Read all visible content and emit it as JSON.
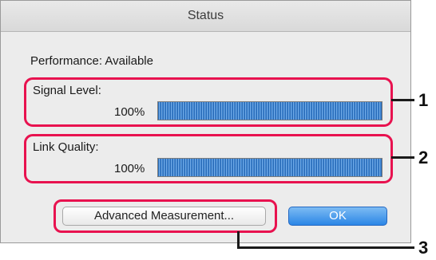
{
  "window": {
    "title": "Status"
  },
  "performance": {
    "text": "Performance: Available"
  },
  "signal": {
    "label": "Signal Level:",
    "percent_text": "100%",
    "value_percent": 100
  },
  "link": {
    "label": "Link Quality:",
    "percent_text": "100%",
    "value_percent": 100
  },
  "buttons": {
    "advanced": "Advanced Measurement...",
    "ok": "OK"
  },
  "callouts": [
    "1",
    "2",
    "3"
  ],
  "colors": {
    "highlight": "#e8124f",
    "ok_button": "#2b86e6",
    "bar_fill": "#3c7ec9"
  }
}
